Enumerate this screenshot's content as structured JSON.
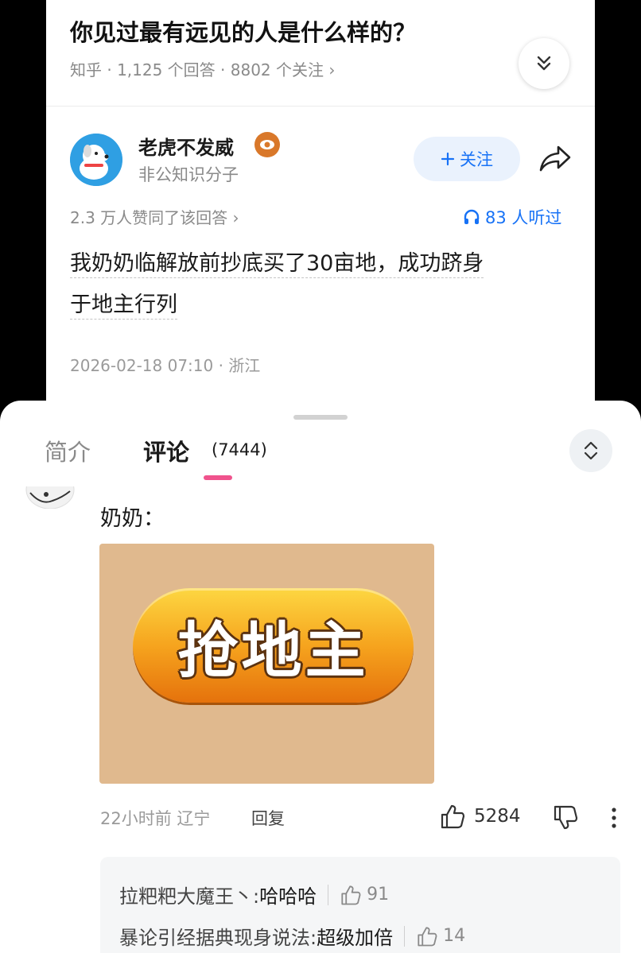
{
  "question": {
    "title": "你见过最有远见的人是什么样的？",
    "meta": "知乎 · 1,125 个回答 · 8802 个关注 ›"
  },
  "author": {
    "name": "老虎不发威",
    "bio": "非公知识分子",
    "follow_label": "关注"
  },
  "answer": {
    "likes_line": "2.3 万人赞同了该回答 ›",
    "listens": "83 人听过",
    "text_line1": "我奶奶临解放前抄底买了30亩地，成功跻身",
    "text_line2": "于地主行列",
    "meta": "2026-02-18 07:10 · 浙江"
  },
  "tabs": {
    "intro": "简介",
    "comments": "评论",
    "comments_count": "(7444)"
  },
  "comment": {
    "text": "奶奶：",
    "image_text": "抢地主",
    "time_location": "22小时前 辽宁",
    "reply_label": "回复",
    "likes": "5284"
  },
  "replies": [
    {
      "user": "拉粑粑大魔王丶: ",
      "content": "哈哈哈",
      "likes": "91"
    },
    {
      "user": "暴论引经据典现身说法: ",
      "content": "超级加倍",
      "likes": "14"
    }
  ],
  "colors": {
    "accent_blue": "#1772f6",
    "tab_indicator": "#f0538d",
    "follow_bg": "#eaf2fd"
  },
  "icons": [
    "chevron-double-down-icon",
    "headphones-icon",
    "share-icon",
    "expand-collapse-icon",
    "thumbs-up-icon",
    "thumbs-down-icon",
    "more-vertical-icon"
  ]
}
